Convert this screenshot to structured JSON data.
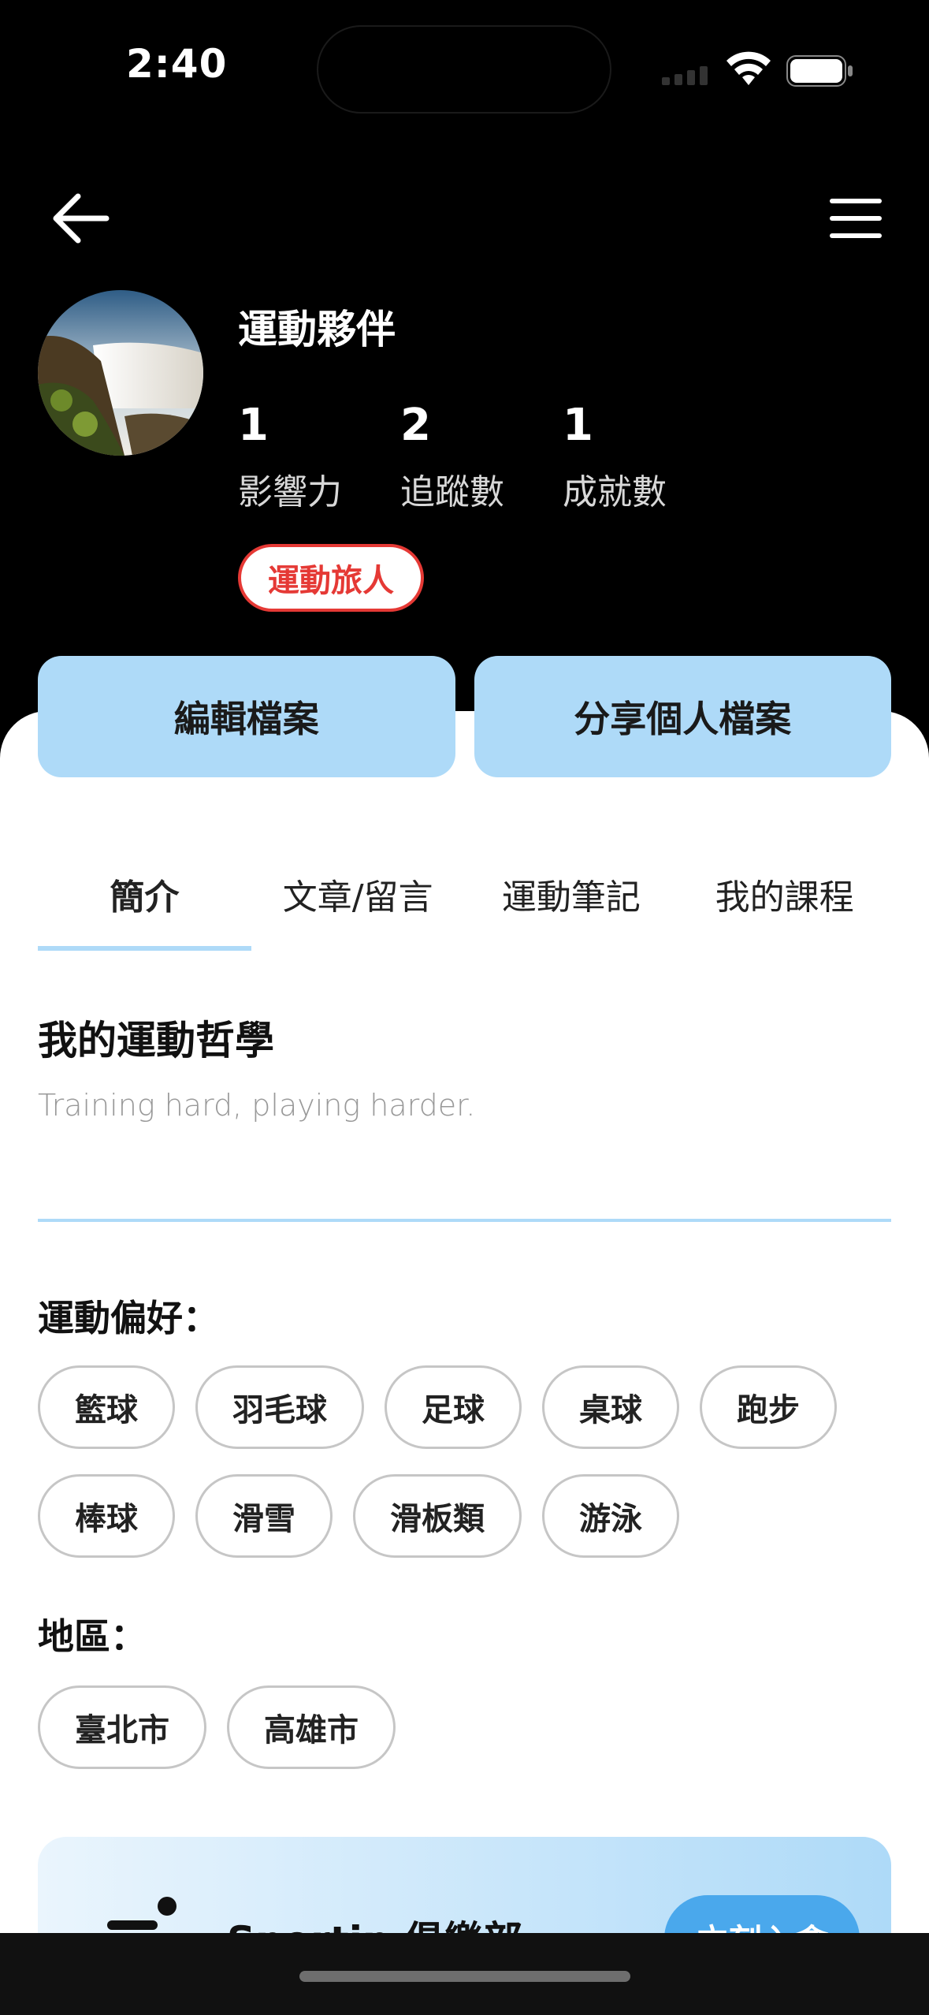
{
  "status_bar": {
    "time": "2:40"
  },
  "profile": {
    "name": "運動夥伴",
    "stats": [
      {
        "value": "1",
        "label": "影響力"
      },
      {
        "value": "2",
        "label": "追蹤數"
      },
      {
        "value": "1",
        "label": "成就數"
      }
    ],
    "badge": "運動旅人"
  },
  "actions": {
    "edit": "編輯檔案",
    "share": "分享個人檔案"
  },
  "tabs": [
    "簡介",
    "文章/留言",
    "運動筆記",
    "我的課程"
  ],
  "about": {
    "title": "我的運動哲學",
    "text": "Training hard, playing harder."
  },
  "preferences": {
    "label": "運動偏好：",
    "items": [
      "籃球",
      "羽毛球",
      "足球",
      "桌球",
      "跑步",
      "棒球",
      "滑雪",
      "滑板類",
      "游泳"
    ]
  },
  "regions": {
    "label": "地區：",
    "items": [
      "臺北市",
      "高雄市"
    ]
  },
  "club": {
    "title": "Sportip 俱樂部",
    "button": "立刻入會"
  },
  "colors": {
    "accent": "#aedaf8",
    "badge_red": "#e53935",
    "join_blue": "#4aa8ec"
  }
}
